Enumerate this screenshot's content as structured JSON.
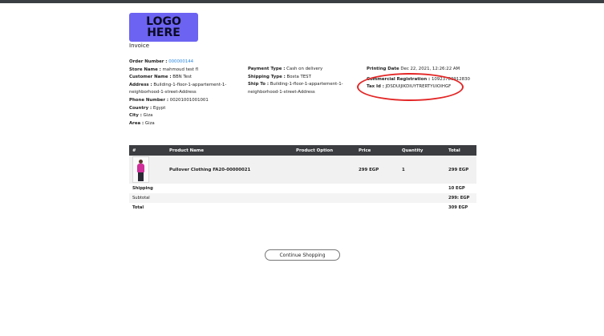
{
  "logo": {
    "line1": "LOGO",
    "line2": "HERE"
  },
  "invoice_title": "Invoice",
  "customer": {
    "order_number_label": "Order Number :",
    "order_number": "000000144",
    "store_name_label": "Store Name :",
    "store_name": "mahmoud test fl",
    "customer_name_label": "Customer Name :",
    "customer_name": "BBN Test",
    "address_label": "Address :",
    "address_line1": "Building-1-floor-1-appartement-1-",
    "address_line2": "neighborhood-1-street-Address",
    "phone_label": "Phone Number :",
    "phone": "00201001001001",
    "country_label": "Country :",
    "country": "Egypt",
    "city_label": "City :",
    "city": "Giza",
    "area_label": "Area :",
    "area": "Giza"
  },
  "shipping": {
    "payment_type_label": "Payment Type :",
    "payment_type": "Cash on delivery",
    "shipping_type_label": "Shipping Type :",
    "shipping_type": "Bosta TEST",
    "ship_to_label": "Ship To :",
    "ship_to_line1": "Building-1-floor-1-appartement-1-",
    "ship_to_line2": "neighborhood-1-street-Address"
  },
  "meta": {
    "printing_date_label": "Printing Date",
    "printing_date": "Dec 22, 2021, 12:26:22 AM",
    "commercial_registration_label": "Commercial Registration :",
    "commercial_registration": "10923780912830",
    "tax_id_label": "Tax Id :",
    "tax_id": "JDSDUIJIKDIUYTRERTYUIOIHGF"
  },
  "table": {
    "headers": [
      "#",
      "Product Name",
      "Product Option",
      "Price",
      "Quantity",
      "Total"
    ],
    "rows": [
      {
        "product_name": "Pullover Clothing FA20-00000021",
        "option": "",
        "price": "299 EGP",
        "quantity": "1",
        "total": "299 EGP"
      }
    ],
    "summary": [
      {
        "label": "Shipping",
        "value": "10 EGP"
      },
      {
        "label": "Subtotal",
        "value": "299: EGP"
      },
      {
        "label": "Total",
        "value": "309 EGP"
      }
    ]
  },
  "continue_button": "Continue Shopping",
  "colors": {
    "accent_link": "#2b87e3",
    "logo_bg": "#6c63f2",
    "table_header_bg": "#3b3d40",
    "highlight": "#e32626"
  }
}
